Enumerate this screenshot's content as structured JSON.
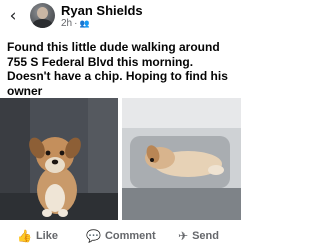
{
  "header": {
    "back_icon": "chevron-left-icon",
    "author_name": "Ryan Shields",
    "post_age": "2h",
    "separator": "·",
    "audience_icon": "friends-icon"
  },
  "post": {
    "text": "Found this little dude walking around 755 S Federal Blvd this morning. Doesn't have a chip. Hoping to find his owner"
  },
  "photos": [
    {
      "description_icon": "dog-photo-in-car-seat"
    },
    {
      "description_icon": "dog-photo-sleeping-on-seat"
    }
  ],
  "actions": {
    "like": "Like",
    "comment": "Comment",
    "send": "Send"
  },
  "colors": {
    "text": "#050505",
    "secondary_text": "#65676b"
  }
}
